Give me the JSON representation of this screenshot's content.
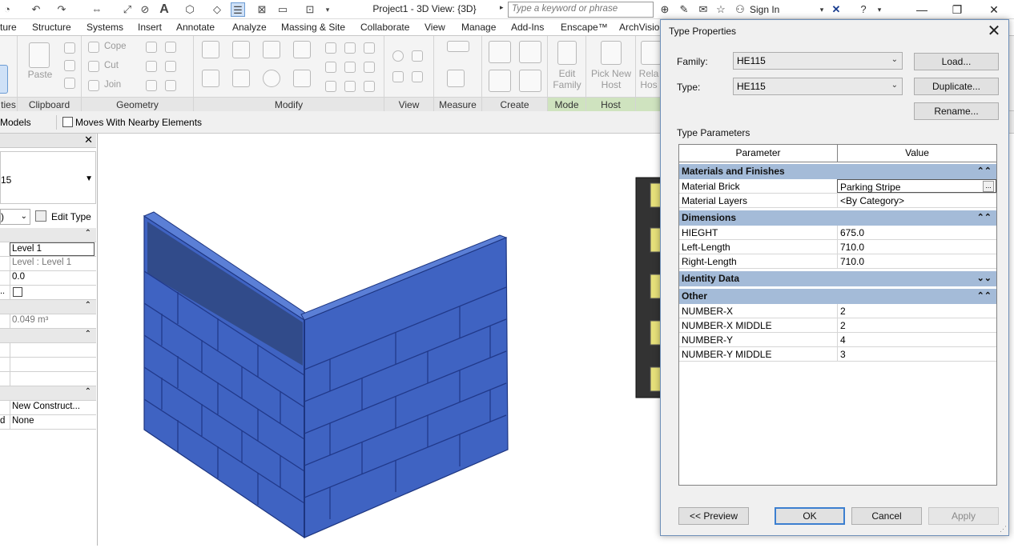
{
  "window": {
    "title": "Project1 - 3D View: {3D}",
    "search_placeholder": "Type a keyword or phrase",
    "sign_in": "Sign In"
  },
  "menu": {
    "tabs": [
      "ture",
      "Structure",
      "Systems",
      "Insert",
      "Annotate",
      "Analyze",
      "Massing & Site",
      "Collaborate",
      "View",
      "Manage",
      "Add-Ins",
      "Enscape™",
      "ArchVisio"
    ]
  },
  "ribbon": {
    "panels": {
      "properties": "ties",
      "clipboard": "Clipboard",
      "geometry": "Geometry",
      "modify": "Modify",
      "view": "View",
      "measure": "Measure",
      "create": "Create",
      "mode": "Mode",
      "host": "Host"
    },
    "paste": "Paste",
    "cope": "Cope",
    "cut": "Cut",
    "join": "Join",
    "edit_family": "Edit Family",
    "pick_new_host": "Pick New Host",
    "rela_host": "Rela Hos"
  },
  "options_bar": {
    "models": "Models",
    "moves_with_nearby": "Moves With Nearby Elements"
  },
  "properties": {
    "type_partial": "15",
    "dropdown_partial": ")",
    "edit_type": "Edit Type",
    "rows": [
      "Level 1",
      "Level : Level 1",
      "0.0",
      "",
      "0.049 m³",
      "New Construct...",
      "None"
    ],
    "left_labels": [
      "",
      "",
      "",
      "..",
      "",
      "",
      "d"
    ]
  },
  "dialog": {
    "title": "Type Properties",
    "family_label": "Family:",
    "family_value": "HE115",
    "type_label": "Type:",
    "type_value": "HE115",
    "load_button": "Load...",
    "duplicate_button": "Duplicate...",
    "rename_button": "Rename...",
    "type_parameters_label": "Type Parameters",
    "col_parameter": "Parameter",
    "col_value": "Value",
    "sections": [
      {
        "title": "Materials and Finishes",
        "chevron": "⌃⌃",
        "rows": [
          {
            "param": "Material Brick",
            "value": "Parking Stripe"
          },
          {
            "param": "Material Layers",
            "value": "<By Category>"
          }
        ]
      },
      {
        "title": "Dimensions",
        "chevron": "⌃⌃",
        "rows": [
          {
            "param": "HIEGHT",
            "value": "675.0"
          },
          {
            "param": "Left-Length",
            "value": "710.0"
          },
          {
            "param": "Right-Length",
            "value": "710.0"
          }
        ]
      },
      {
        "title": "Identity Data",
        "chevron": "⌄⌄",
        "rows": []
      },
      {
        "title": "Other",
        "chevron": "⌃⌃",
        "rows": [
          {
            "param": "NUMBER-X",
            "value": "2"
          },
          {
            "param": "NUMBER-X MIDDLE",
            "value": "2"
          },
          {
            "param": "NUMBER-Y",
            "value": "4"
          },
          {
            "param": "NUMBER-Y MIDDLE",
            "value": "3"
          }
        ]
      }
    ],
    "preview_button": "<< Preview",
    "ok_button": "OK",
    "cancel_button": "Cancel",
    "apply_button": "Apply"
  },
  "colors": {
    "brick_blue": "#3f63c2",
    "section_header": "#a4bbd8",
    "mode_panel": "#cfe3bf"
  }
}
